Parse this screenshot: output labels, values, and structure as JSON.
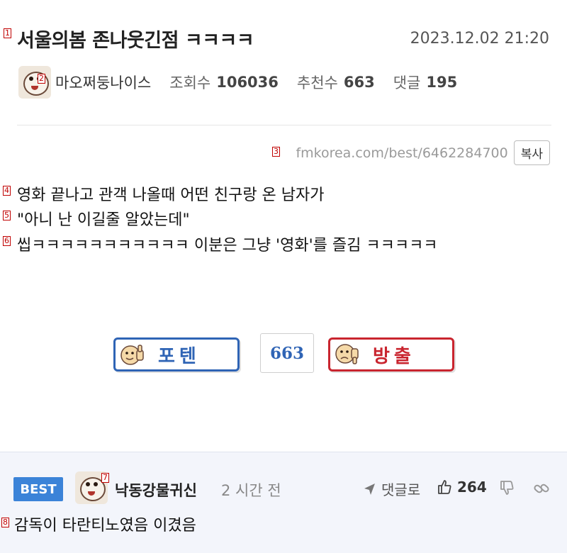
{
  "post": {
    "title": "서울의봄 존나웃긴점 ㅋㅋㅋㅋ",
    "date": "2023.12.02 21:20",
    "author": "마오쩌둥나이스",
    "views_label": "조회수",
    "views": "106036",
    "recommend_label": "추천수",
    "recommend": "663",
    "comments_label": "댓글",
    "comments": "195",
    "url": "fmkorea.com/best/6462284700",
    "copy_label": "복사",
    "body_lines": [
      "영화 끝나고 관객 나올때 어떤 친구랑 온 남자가",
      "\"아니 난 이길줄 알았는데\"",
      "씹ㅋㅋㅋㅋㅋㅋㅋㅋㅋㅋㅋ 이분은 그냥 '영화'를 즐김 ㅋㅋㅋㅋㅋ"
    ]
  },
  "vote": {
    "up_label": "포텐",
    "count": "663",
    "down_label": "방출",
    "up_color": "#2f64b5",
    "down_color": "#c9252f"
  },
  "comment": {
    "badge": "BEST",
    "author": "낙동강물귀신",
    "time": "2 시간 전",
    "reply_label": "댓글로",
    "likes": "264",
    "body": "감독이 타란티노였음 이겼음",
    "badge_color": "#3b83d8"
  },
  "markers": [
    "1",
    "2",
    "3",
    "4",
    "5",
    "6",
    "7",
    "8"
  ],
  "icons": {
    "reply": "send-arrow-icon",
    "like": "thumbs-up-icon",
    "dislike": "thumbs-down-icon",
    "link": "link-icon"
  }
}
